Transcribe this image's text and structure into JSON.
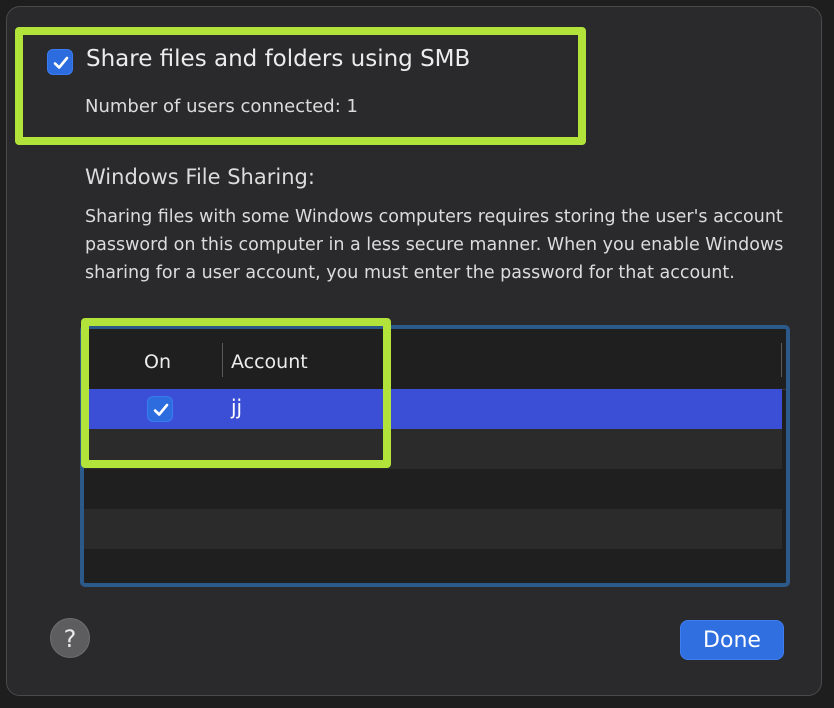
{
  "smb": {
    "label": "Share files and folders using SMB",
    "checked": true,
    "users_connected": "Number of users connected: 1"
  },
  "windows_sharing": {
    "title": "Windows File Sharing:",
    "description": "Sharing files with some Windows computers requires storing the user's account password on this computer in a less secure manner. When you enable Windows sharing for a user account, you must enter the password for that account."
  },
  "accounts_table": {
    "columns": [
      "On",
      "Account"
    ],
    "rows": [
      {
        "on": true,
        "account": "jj"
      }
    ]
  },
  "buttons": {
    "help_label": "?",
    "done_label": "Done"
  },
  "colors": {
    "accent": "#2f6fe0",
    "selection": "#3b4ed6",
    "highlight": "#b2e33a"
  }
}
